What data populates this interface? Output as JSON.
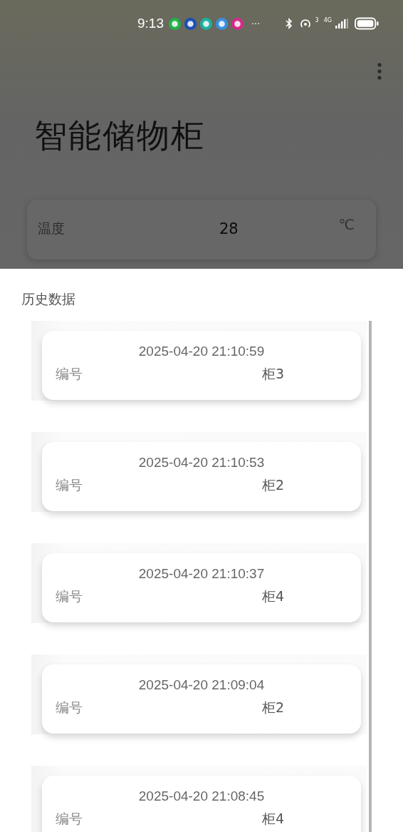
{
  "status_bar": {
    "time": "9:13",
    "more": "···",
    "wifi_badge": "3",
    "network": "4G"
  },
  "app": {
    "title": "智能储物柜",
    "readings": [
      {
        "label": "温度",
        "value": "28",
        "unit": "℃"
      }
    ]
  },
  "sheet": {
    "title": "历史数据",
    "records": [
      {
        "time": "2025-04-20 21:10:59",
        "label": "编号",
        "cabinet": "柜3"
      },
      {
        "time": "2025-04-20 21:10:53",
        "label": "编号",
        "cabinet": "柜2"
      },
      {
        "time": "2025-04-20 21:10:37",
        "label": "编号",
        "cabinet": "柜4"
      },
      {
        "time": "2025-04-20 21:09:04",
        "label": "编号",
        "cabinet": "柜2"
      },
      {
        "time": "2025-04-20 21:08:45",
        "label": "编号",
        "cabinet": "柜4"
      }
    ]
  }
}
